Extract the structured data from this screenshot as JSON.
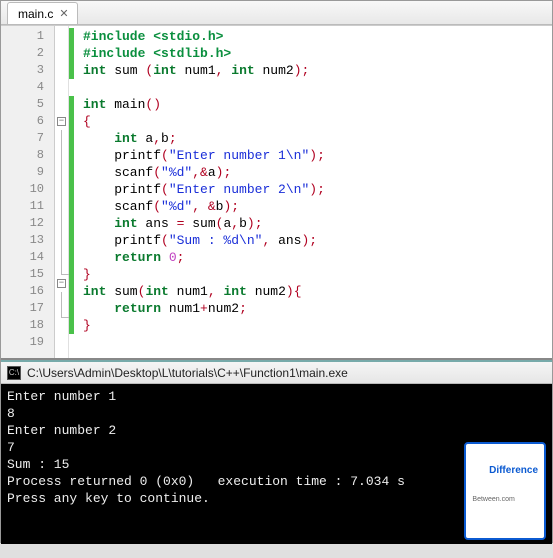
{
  "tab": {
    "label": "main.c"
  },
  "code": {
    "lines": [
      {
        "n": 1,
        "mark": true,
        "fold": "",
        "html": "<span class='pp'>#include &lt;stdio.h&gt;</span>"
      },
      {
        "n": 2,
        "mark": true,
        "fold": "",
        "html": "<span class='pp'>#include &lt;stdlib.h&gt;</span>"
      },
      {
        "n": 3,
        "mark": true,
        "fold": "",
        "html": "<span class='kw'>int</span> sum <span class='op'>(</span><span class='kw'>int</span> num1<span class='op'>,</span> <span class='kw'>int</span> num2<span class='op'>);</span>"
      },
      {
        "n": 4,
        "mark": false,
        "fold": "",
        "html": ""
      },
      {
        "n": 5,
        "mark": true,
        "fold": "",
        "html": "<span class='kw'>int</span> main<span class='op'>()</span>"
      },
      {
        "n": 6,
        "mark": true,
        "fold": "minus",
        "html": "<span class='op'>{</span>"
      },
      {
        "n": 7,
        "mark": true,
        "fold": "line",
        "html": "    <span class='kw'>int</span> a<span class='op'>,</span>b<span class='op'>;</span>"
      },
      {
        "n": 8,
        "mark": true,
        "fold": "line",
        "html": "    printf<span class='op'>(</span><span class='str'>\"Enter number 1\\n\"</span><span class='op'>);</span>"
      },
      {
        "n": 9,
        "mark": true,
        "fold": "line",
        "html": "    scanf<span class='op'>(</span><span class='str'>\"%d\"</span><span class='op'>,&amp;</span>a<span class='op'>);</span>"
      },
      {
        "n": 10,
        "mark": true,
        "fold": "line",
        "html": "    printf<span class='op'>(</span><span class='str'>\"Enter number 2\\n\"</span><span class='op'>);</span>"
      },
      {
        "n": 11,
        "mark": true,
        "fold": "line",
        "html": "    scanf<span class='op'>(</span><span class='str'>\"%d\"</span><span class='op'>, &amp;</span>b<span class='op'>);</span>"
      },
      {
        "n": 12,
        "mark": true,
        "fold": "line",
        "html": "    <span class='kw'>int</span> ans <span class='op'>=</span> sum<span class='op'>(</span>a<span class='op'>,</span>b<span class='op'>);</span>"
      },
      {
        "n": 13,
        "mark": true,
        "fold": "line",
        "html": "    printf<span class='op'>(</span><span class='str'>\"Sum : %d\\n\"</span><span class='op'>,</span> ans<span class='op'>);</span>"
      },
      {
        "n": 14,
        "mark": true,
        "fold": "line",
        "html": "    <span class='kw'>return</span> <span class='num'>0</span><span class='op'>;</span>"
      },
      {
        "n": 15,
        "mark": true,
        "fold": "end",
        "html": "<span class='op'>}</span>"
      },
      {
        "n": 16,
        "mark": true,
        "fold": "minus",
        "html": "<span class='kw'>int</span> sum<span class='op'>(</span><span class='kw'>int</span> num1<span class='op'>,</span> <span class='kw'>int</span> num2<span class='op'>){</span>"
      },
      {
        "n": 17,
        "mark": true,
        "fold": "line",
        "html": "    <span class='kw'>return</span> num1<span class='op'>+</span>num2<span class='op'>;</span>"
      },
      {
        "n": 18,
        "mark": true,
        "fold": "end",
        "html": "<span class='op'>}</span>"
      },
      {
        "n": 19,
        "mark": false,
        "fold": "",
        "html": ""
      }
    ]
  },
  "console": {
    "title": "C:\\Users\\Admin\\Desktop\\L\\tutorials\\C++\\Function1\\main.exe",
    "lines": [
      "Enter number 1",
      "8",
      "Enter number 2",
      "7",
      "Sum : 15",
      "",
      "Process returned 0 (0x0)   execution time : 7.034 s",
      "Press any key to continue."
    ]
  },
  "watermark": {
    "top": "Difference",
    "bottom": "Between.com"
  }
}
